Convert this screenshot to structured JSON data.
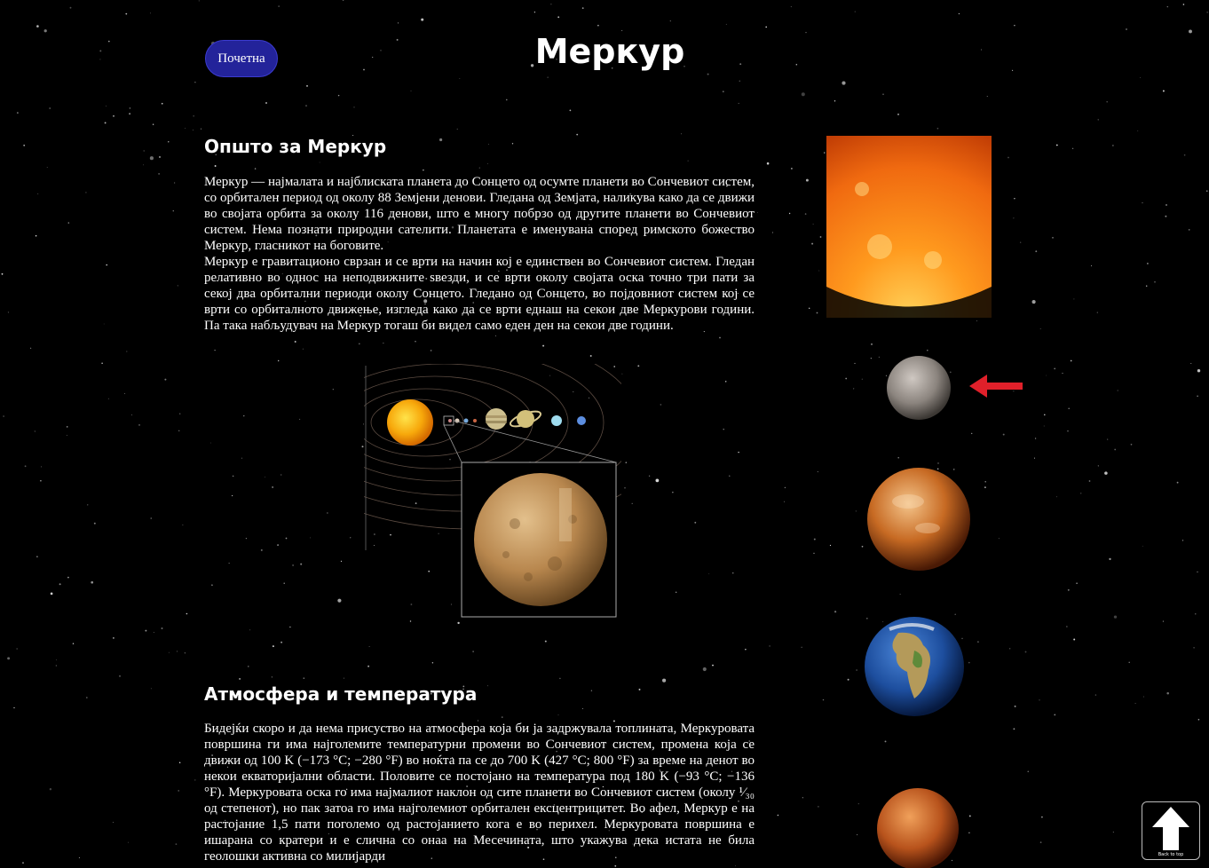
{
  "header": {
    "home_label": "Почетна",
    "title": "Меркур"
  },
  "sections": [
    {
      "title": "Општо за Меркур",
      "paragraphs": [
        "Меркур — најмалата и најблиската планета до Сонцето од осумте планети во Сончевиот систем, со орбитален период од околу 88 Земјени денови. Гледана од Земјата, наликува како да се движи во својата орбита за околу 116 денови, што е многу побрзо од другите планети во Сончевиот систем. Нема познати природни сателити. Планетата е именувана според римското божество Меркур, гласникот на боговите.",
        "Меркур е гравитационо сврзан и се врти на начин кој е единствен во Сончевиот систем. Гледан релативно во однос на неподвижните ѕвезди, и се врти околу својата оска точно три пати за секој два орбитални периоди околу Сонцето. Гледано од Сонцето, во појдовниот систем кој се врти со орбиталното движење, изгледа како да се врти еднаш на секои две Меркурови години. Па така набљудувач на Меркур тогаш би видел само еден ден на секои две години."
      ]
    },
    {
      "title": "Атмосфера и температура",
      "paragraphs": [
        "Бидејќи скоро и да нема присуство на атмосфера која би ја задржувала топлината, Меркуровата површина ги има најголемите температурни промени во Сончевиот систем, промена која се движи од 100 K (−173 °C; −280 °F) во ноќта па се до 700 K (427 °C; 800 °F) за време на денот во некои екваторијални области. Половите се постојано на температура под 180 K (−93 °C; −136 °F). Меркуровата оска го има најмалиот наклон од сите планети во Сончевиот систем (околу ¹⁄₃₀ од степенот), но пак затоа го има најголемиот орбитален ексцентрицитет. Во афел, Меркур е на растојание 1,5 пати поголемо од растојанието кога е во перихел. Меркуровата површина е ишарана со кратери и е слична со онаа на Месечината, што укажува дека истата не била геолошки активна со милијарди"
      ]
    }
  ],
  "sidebar": {
    "items": [
      {
        "name": "sun"
      },
      {
        "name": "mercury",
        "current": true
      },
      {
        "name": "venus"
      },
      {
        "name": "earth"
      },
      {
        "name": "mars"
      }
    ],
    "indicator_color": "#e0202a"
  },
  "back_to_top": {
    "label": "Back to top"
  },
  "colors": {
    "background": "#000000",
    "button": "#23239a",
    "text": "#ffffff"
  }
}
